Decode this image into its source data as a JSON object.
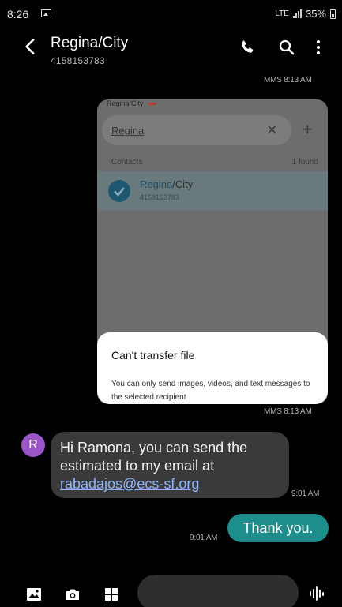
{
  "status": {
    "time": "8:26",
    "network": "LTE",
    "battery": "35%"
  },
  "header": {
    "title": "Regina/City",
    "number": "4158153783"
  },
  "mms": {
    "chip_label": "Regina/City",
    "search_value": "Regina",
    "contacts_label": "Contacts",
    "found_count": "1 found",
    "contact_name_match": "Regina",
    "contact_name_rest": "/City",
    "contact_number": "4158153783",
    "stamp_top": "MMS 8:13 AM",
    "stamp_bottom": "MMS 8:13 AM"
  },
  "dialog": {
    "title": "Can't transfer file",
    "body": "You can only send images, videos, and text messages to the selected recipient."
  },
  "incoming": {
    "avatar_letter": "R",
    "text": "Hi Ramona, you can send the estimated to my email at",
    "email": "rabadajos@ecs-sf.org",
    "time": "9:01 AM"
  },
  "outgoing": {
    "text": "Thank you.",
    "time": "9:01 AM"
  },
  "colors": {
    "outgoing_bubble": "#1c8f8c",
    "incoming_bubble": "#3a3a3a",
    "avatar": "#9b55c7",
    "link": "#8fb7ff"
  },
  "icons": [
    "back-arrow-icon",
    "phone-icon",
    "search-icon",
    "more-vert-icon",
    "gallery-icon",
    "camera-icon",
    "apps-grid-icon",
    "voice-waveform-icon"
  ]
}
